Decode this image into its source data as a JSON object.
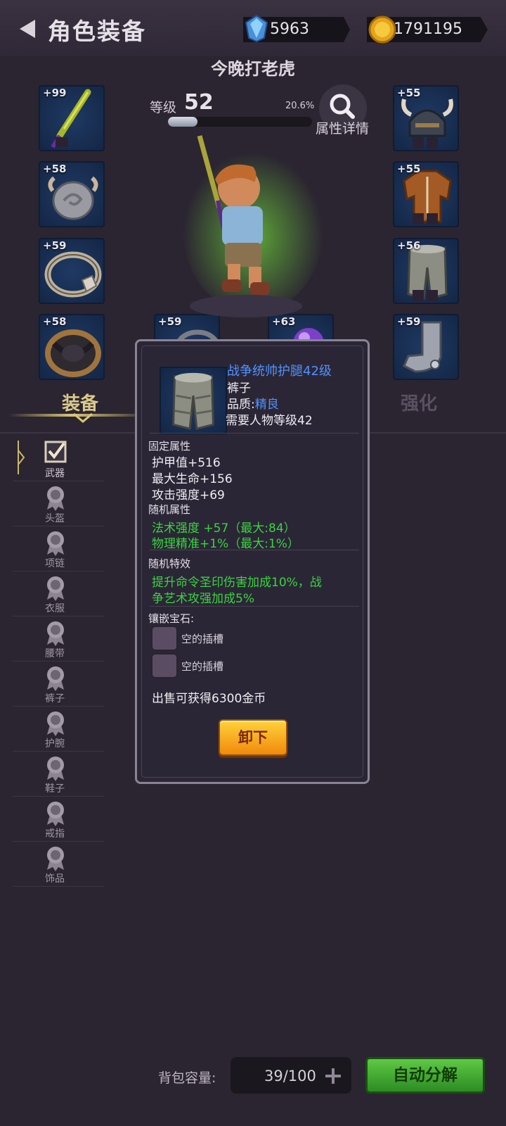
{
  "header": {
    "title": "角色装备",
    "gems": "5963",
    "gold": "1791195"
  },
  "character": {
    "name": "今晚打老虎",
    "level_label": "等级",
    "level": "52",
    "exp_percent": "20.6%",
    "exp_fraction": 0.206,
    "detail_label": "属性详情"
  },
  "slots": {
    "weapon": "+99",
    "helmet": "+55",
    "amulet": "+58",
    "armor": "+55",
    "ring": "+59",
    "pants": "+56",
    "belt": "+58",
    "bracer": "+59",
    "slot_mid_left": "+59",
    "slot_mid_right": "+63"
  },
  "tabs": {
    "equip": "装备",
    "enhance": "强化"
  },
  "filters": [
    {
      "label": "武器",
      "active": true
    },
    {
      "label": "头盔"
    },
    {
      "label": "项链"
    },
    {
      "label": "衣服"
    },
    {
      "label": "腰带"
    },
    {
      "label": "裤子"
    },
    {
      "label": "护腕"
    },
    {
      "label": "鞋子"
    },
    {
      "label": "戒指"
    },
    {
      "label": "饰品"
    }
  ],
  "popup": {
    "item_name": "战争统帅护腿42级",
    "item_type": "裤子",
    "quality_label": "品质:",
    "quality": "精良",
    "required_level": "需要人物等级42",
    "fixed_title": "固定属性",
    "fixed": [
      "护甲值+516",
      "最大生命+156",
      "攻击强度+69"
    ],
    "random_title": "随机属性",
    "random": [
      "法术强度 +57（最大:84）",
      "物理精准+1%（最大:1%）"
    ],
    "effect_title": "随机特效",
    "effect_line1": "提升命令圣印伤害加成10%，战",
    "effect_line2": "争艺术攻强加成5%",
    "gem_title": "镶嵌宝石:",
    "empty_socket": "空的插槽",
    "sell_text": "出售可获得6300金币",
    "unequip": "卸下"
  },
  "footer": {
    "bag_label": "背包容量:",
    "bag_value": "39/100",
    "auto_decompose": "自动分解"
  }
}
